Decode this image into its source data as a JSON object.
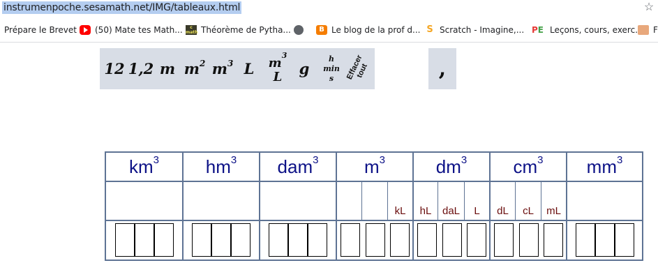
{
  "browser": {
    "url": "instrumenpoche.sesamath.net/IMG/tableaux.html",
    "bookmarks": [
      {
        "label": "Prépare le Brevet",
        "icon": "none"
      },
      {
        "label": "(50) Mate tes Math...",
        "icon": "youtube-icon"
      },
      {
        "label": "Théorème de Pytha...",
        "icon": "math-site-icon"
      },
      {
        "label": "",
        "icon": "globe-icon"
      },
      {
        "label": "Le blog de la prof d...",
        "icon": "blogger-icon"
      },
      {
        "label": "Scratch - Imagine,...",
        "icon": "scratch-icon"
      },
      {
        "label": "Leçons, cours, exerc...",
        "icon": "pe-icon"
      },
      {
        "label": "F",
        "icon": "user-icon"
      }
    ],
    "colors": {
      "selection": "#b4cdf0"
    }
  },
  "toolbar": {
    "buttons": [
      "12",
      "1,2",
      "m",
      "m",
      "m",
      "L"
    ],
    "sup2": "2",
    "sup3": "3",
    "frac_top": "m",
    "frac_bottom": "L",
    "g": "g",
    "time_units": [
      "h",
      "min",
      "s"
    ],
    "erase_line1": "Effacer",
    "erase_line2": "tout",
    "comma": ","
  },
  "table": {
    "headers": [
      {
        "unit": "km",
        "exp": "3"
      },
      {
        "unit": "hm",
        "exp": "3"
      },
      {
        "unit": "dam",
        "exp": "3"
      },
      {
        "unit": "m",
        "exp": "3"
      },
      {
        "unit": "dm",
        "exp": "3"
      },
      {
        "unit": "cm",
        "exp": "3"
      },
      {
        "unit": "mm",
        "exp": "3"
      }
    ],
    "capacity_labels": [
      "kL",
      "hL",
      "daL",
      "L",
      "dL",
      "cL",
      "mL"
    ],
    "colors": {
      "header_text": "#0d1287",
      "capacity_text": "#6a0d0d",
      "border": "#5e7394",
      "toolbar_bg": "#d8dde6"
    }
  }
}
